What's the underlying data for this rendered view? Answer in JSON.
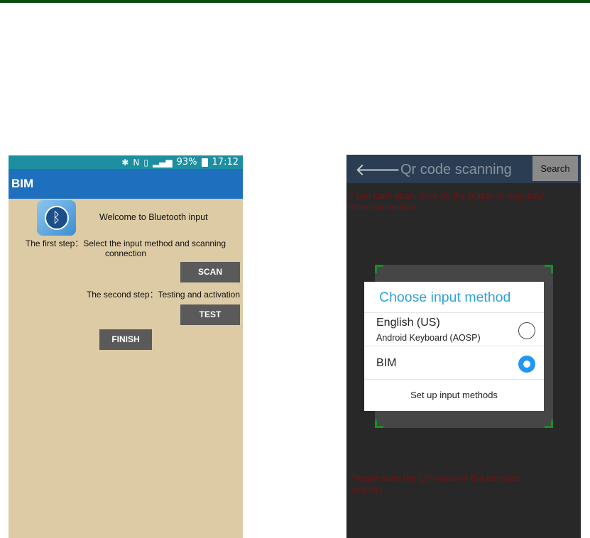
{
  "left_screen": {
    "status": {
      "bluetooth_icon": "bluetooth-icon",
      "nfc_icon": "nfc-icon",
      "mute_icon": "vibrate-icon",
      "signal_icon": "signal-icon",
      "battery": "93%",
      "time": "17:12"
    },
    "app_title": "BIM",
    "welcome": "Welcome to Bluetooth input",
    "step1": "The first step：Select the input method and scanning connection",
    "scan_label": "SCAN",
    "step2": "The second step：Testing and activation",
    "test_label": "TEST",
    "finish_label": "FINISH"
  },
  "right_screen": {
    "title": "Qr code scanning",
    "search_label": "Search",
    "top_hint": "If you can't scan, click on the button to manually enter connection",
    "bottom_hint": "Please scan the QR code on the barcode scanner",
    "dialog": {
      "title": "Choose input method",
      "options": [
        {
          "label": "English (US)",
          "sub": "Android Keyboard (AOSP)",
          "selected": false
        },
        {
          "label": "BIM",
          "sub": "",
          "selected": true
        }
      ],
      "setup_label": "Set up input methods"
    }
  },
  "colors": {
    "accent": "#2fa2d8",
    "app_bar": "#1f6fbf",
    "left_bg": "#dccba4",
    "radio_selected": "#2196f3"
  }
}
